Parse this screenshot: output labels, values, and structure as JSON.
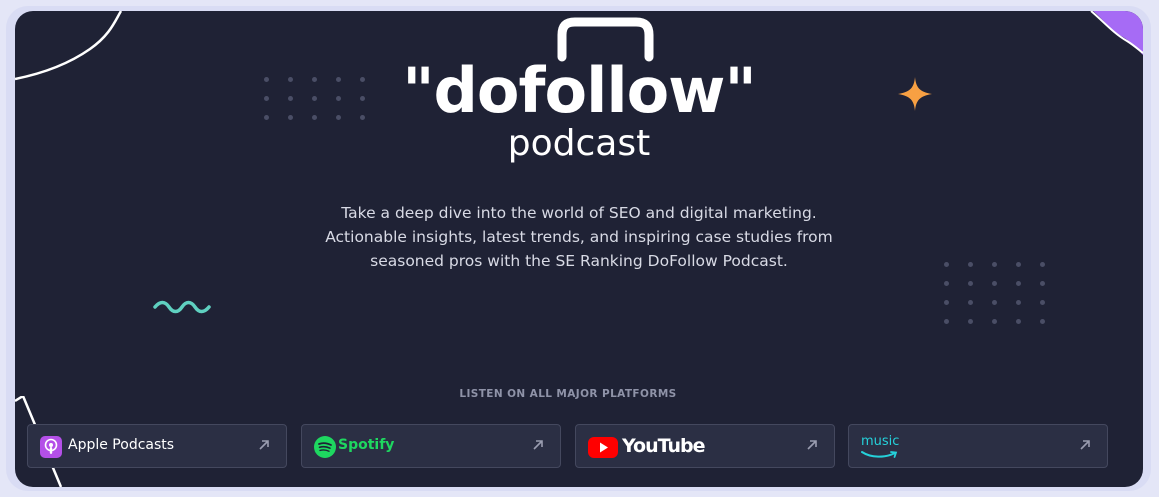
{
  "logo": {
    "word": "\"dofollow\"",
    "sub": "podcast"
  },
  "description": {
    "line1": "Take a deep dive into the world of SEO and digital marketing.",
    "line2": "Actionable insights, latest trends, and inspiring case studies from",
    "line3": "seasoned pros with the SE Ranking DoFollow Podcast."
  },
  "listen_label": "LISTEN ON ALL MAJOR PLATFORMS",
  "platforms": [
    {
      "label": "Apple Podcasts",
      "icon": "apple-podcasts-icon",
      "color": "#b450e8"
    },
    {
      "label": "Spotify",
      "icon": "spotify-icon",
      "color": "#1ed760"
    },
    {
      "label": "YouTube",
      "icon": "youtube-icon",
      "color": "#ff0000"
    },
    {
      "label": "music",
      "icon": "amazon-music-icon",
      "color": "#25d1da"
    }
  ],
  "colors": {
    "background": "#1f2235",
    "accent_orange": "#f7a043",
    "accent_teal": "#5fd0c0",
    "accent_purple": "#a66bf5"
  }
}
